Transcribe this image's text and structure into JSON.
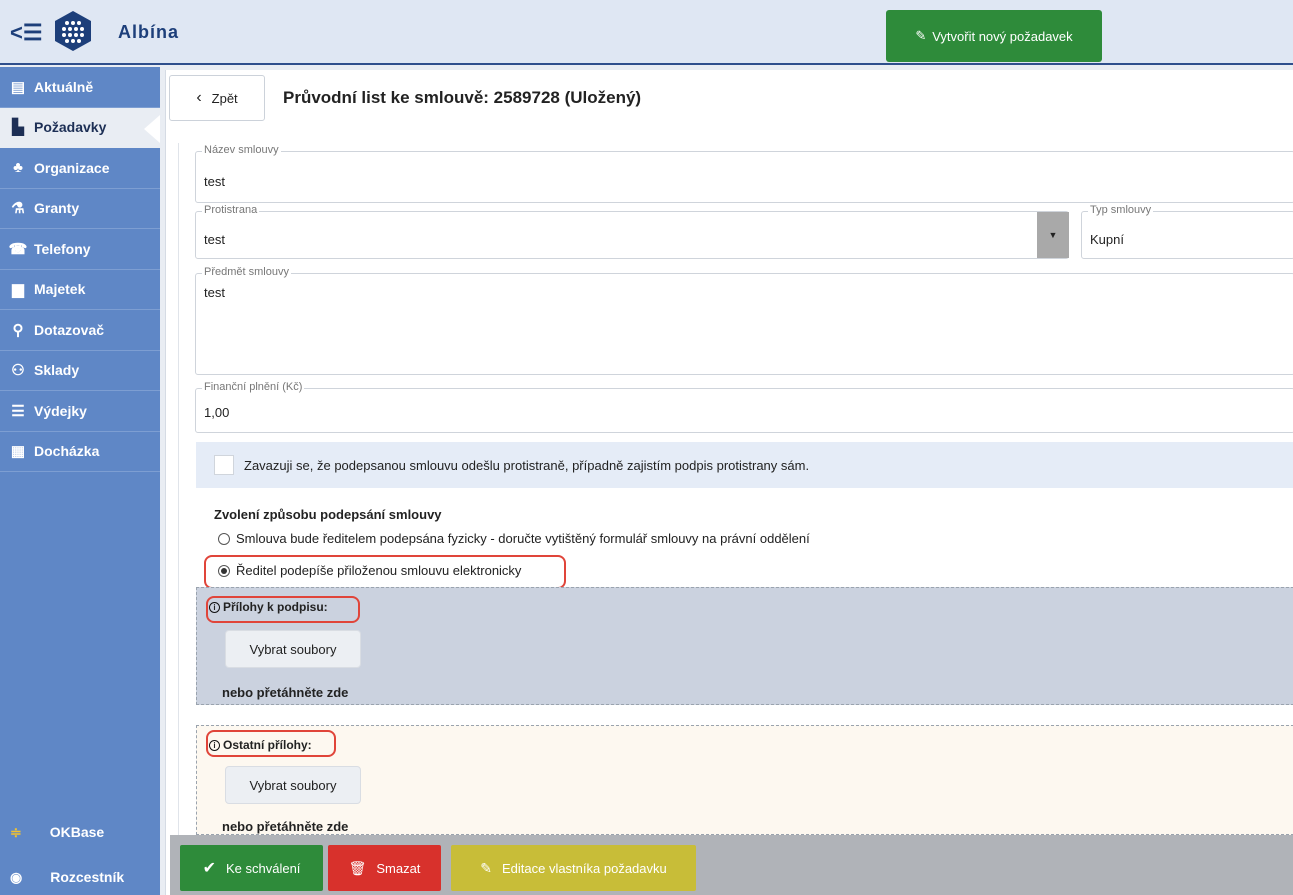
{
  "app": {
    "name": "Albína",
    "new_request_label": "Vytvořit nový požadavek"
  },
  "sidebar": {
    "items": [
      {
        "label": "Aktuálně",
        "icon": "newspaper-icon"
      },
      {
        "label": "Požadavky",
        "icon": "file-signature-icon"
      },
      {
        "label": "Organizace",
        "icon": "sitemap-icon"
      },
      {
        "label": "Granty",
        "icon": "flask-icon"
      },
      {
        "label": "Telefony",
        "icon": "phone-icon"
      },
      {
        "label": "Majetek",
        "icon": "briefcase-icon"
      },
      {
        "label": "Dotazovač",
        "icon": "search-icon"
      },
      {
        "label": "Sklady",
        "icon": "people-carry-icon"
      },
      {
        "label": "Výdejky",
        "icon": "receipt-icon"
      },
      {
        "label": "Docházka",
        "icon": "calendar-icon"
      }
    ],
    "active_index": 1,
    "bottom": [
      {
        "label": "OKBase",
        "icon": "okbase-icon"
      },
      {
        "label": "Rozcestník",
        "icon": "crossroads-icon"
      }
    ]
  },
  "header": {
    "back_label": "Zpět",
    "title": "Průvodní list ke smlouvě: 2589728 (Uložený)"
  },
  "form": {
    "name": {
      "label": "Název smlouvy",
      "value": "test"
    },
    "counterparty": {
      "label": "Protistrana",
      "value": "test"
    },
    "contract_type": {
      "label": "Typ smlouvy",
      "value": "Kupní"
    },
    "subject": {
      "label": "Předmět smlouvy",
      "value": "test"
    },
    "financial": {
      "label": "Finanční plnění (Kč)",
      "value": "1,00"
    },
    "consent_text": "Zavazuji se, že podepsanou smlouvu odešlu protistraně, případně zajistím podpis protistrany sám.",
    "sign_method_title": "Zvolení způsobu podepsání smlouvy",
    "sign_options": [
      "Smlouva bude ředitelem podepsána fyzicky - doručte vytištěný formulář smlouvy na právní oddělení",
      "Ředitel podepíše přiloženou smlouvu elektronicky"
    ],
    "selected_option_index": 1
  },
  "attachments": {
    "sign_title": "Přílohy k podpisu:",
    "other_title": "Ostatní přílohy:",
    "pick_label": "Vybrat soubory",
    "drop_label": "nebo přetáhněte zde"
  },
  "actions": {
    "approve_label": "Ke schválení",
    "delete_label": "Smazat",
    "edit_owner_label": "Editace vlastníka požadavku"
  },
  "colors": {
    "accent": "#5f87c6",
    "approve": "#2e8b3a",
    "delete": "#d8312c",
    "edit": "#c8bd38",
    "highlight": "#e0453a"
  }
}
